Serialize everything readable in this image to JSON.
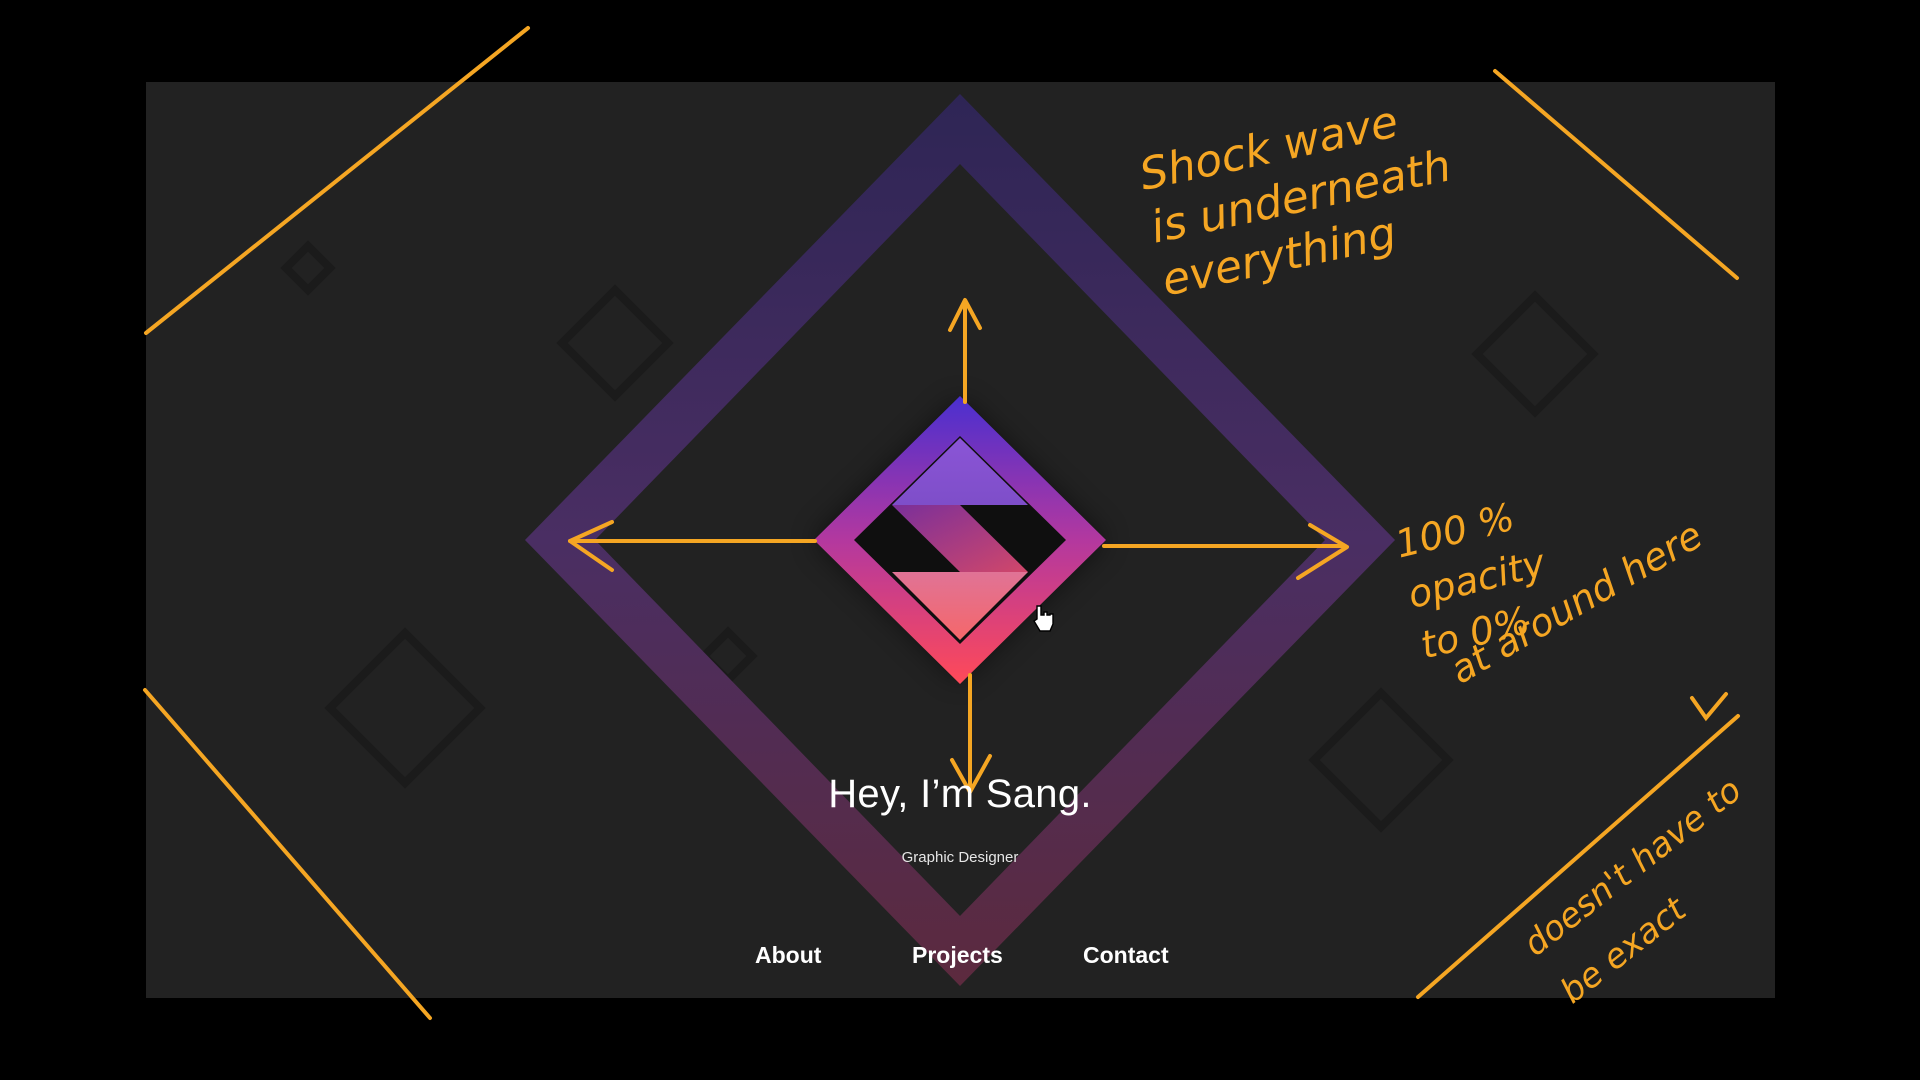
{
  "hero": {
    "headline": "Hey, I’m Sang.",
    "subtitle": "Graphic Designer"
  },
  "nav": {
    "items": [
      {
        "label": "About"
      },
      {
        "label": "Projects"
      },
      {
        "label": "Contact"
      }
    ]
  },
  "annotations": {
    "shockwave": "Shock wave\nis underneath\neverything",
    "opacity": "100 %\nopacity\nto 0%",
    "opacity_2": "at around here",
    "exact": "doesn't have to\nbe exact"
  },
  "icons": [
    "logo-s-icon",
    "pointer-cursor-icon"
  ],
  "colors": {
    "background": "#222222",
    "frame": "#000000",
    "gradient_top": "#4a2fc4",
    "gradient_bottom": "#ff4f5e",
    "annotation": "#f5a623"
  }
}
